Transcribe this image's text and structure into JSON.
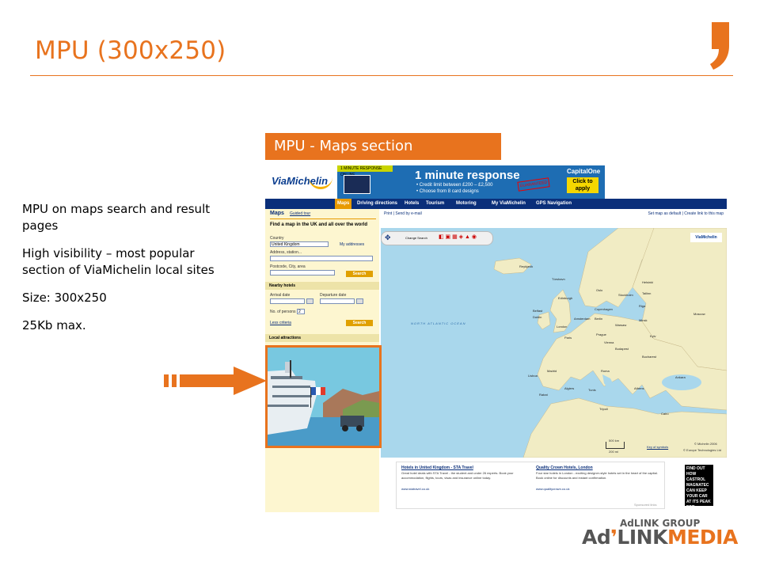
{
  "slide": {
    "title": "MPU (300x250)",
    "accent_color": "#E8731E"
  },
  "bullets": [
    "MPU on maps search and result pages",
    "High visibility – most popular section of ViaMichelin local sites",
    "Size: 300x250",
    "25Kb max."
  ],
  "section_label": "MPU - Maps section",
  "screenshot": {
    "logo": "ViaMichelin",
    "banner": {
      "strip": "1 MINUTE RESPONSE ONLINE",
      "headline": "1 minute response",
      "line1": "• Credit limit between £200 – £2,500",
      "line2": "• Choose from 8 card designs",
      "stamp": "GUARANTEED",
      "brand": "CapitalOne",
      "cta": "Click to apply"
    },
    "nav": [
      "Maps",
      "Driving directions",
      "Hotels",
      "Tourism",
      "Motoring",
      "My ViaMichelin",
      "GPS Navigation"
    ],
    "sidebar": {
      "title": "Maps",
      "guided_tour": "Guided tour",
      "heading": "Find a map in the UK and all over the world",
      "country_label": "Country",
      "country_value": "United Kingdom",
      "my_addresses": "My addresses",
      "address_label": "Address, station...",
      "postcode_label": "Postcode, City, area",
      "search_button": "Search",
      "nearby_hotels": "Nearby hotels",
      "arrival_label": "Arrival date",
      "departure_label": "Departure date",
      "persons_label": "No. of persons",
      "persons_value": "2",
      "less_criteria": "Less criteria",
      "search_button2": "Search",
      "local_attractions": "Local attractions"
    },
    "map_tools": {
      "print": "Print",
      "send": "Send",
      "by_email": "by e-mail",
      "set_default": "Set map as default",
      "create_link": "Create link to this map",
      "change_search": "Change Search",
      "map_logo": "ViaMichelin"
    },
    "map": {
      "ocean": "NORTH   ATLANTIC   OCEAN",
      "key": "Key of symbols",
      "copyright1": "© Michelin 2006",
      "copyright2": "© Europe Technologies Ltd",
      "scale_km": "500 km",
      "scale_mi": "200 mi",
      "cities": [
        {
          "n": "Reykjavik"
        },
        {
          "n": "Tórshavn"
        },
        {
          "n": "Oslo"
        },
        {
          "n": "Stockholm"
        },
        {
          "n": "Helsinki"
        },
        {
          "n": "Tallinn"
        },
        {
          "n": "Riga"
        },
        {
          "n": "Edinburgh"
        },
        {
          "n": "Copenhagen"
        },
        {
          "n": "Belfast"
        },
        {
          "n": "Dublin"
        },
        {
          "n": "London"
        },
        {
          "n": "Amsterdam"
        },
        {
          "n": "Berlin"
        },
        {
          "n": "Warsaw"
        },
        {
          "n": "Minsk"
        },
        {
          "n": "Moscow"
        },
        {
          "n": "Kyiv"
        },
        {
          "n": "Paris"
        },
        {
          "n": "Prague"
        },
        {
          "n": "Vienna"
        },
        {
          "n": "Budapest"
        },
        {
          "n": "Bucharest"
        },
        {
          "n": "Madrid"
        },
        {
          "n": "Lisboa"
        },
        {
          "n": "Roma"
        },
        {
          "n": "Athens"
        },
        {
          "n": "Ankara"
        },
        {
          "n": "Algiers"
        },
        {
          "n": "Tunis"
        },
        {
          "n": "Rabat"
        },
        {
          "n": "Tripoli"
        },
        {
          "n": "Cairo"
        }
      ]
    },
    "ads": [
      {
        "title": "Hotels in United Kingdom - STA Travel",
        "text": "Great hotel deals with STA Travel - the student and under 26 experts. Book your accommodation, flights, tours, visas and insurance online today.",
        "url": "www.statravel.co.uk"
      },
      {
        "title": "Quality Crown Hotels, London",
        "text": "Four star hotels in London - exciting designer-style hotels set in the heart of the capital. Book online for discounts and instant confirmation.",
        "url": "www.qualitycrown.co.uk"
      }
    ],
    "sponsored": "Sponsored links",
    "castrol": "FIND OUT HOW CASTROL MAGNATEC CAN KEEP YOUR CAR AT ITS PEAK FOR LONGER"
  },
  "footer": {
    "group": "AdLINK GROUP",
    "brand_ad": "Ad",
    "brand_link": "LINK",
    "brand_media": "MEDIA"
  }
}
